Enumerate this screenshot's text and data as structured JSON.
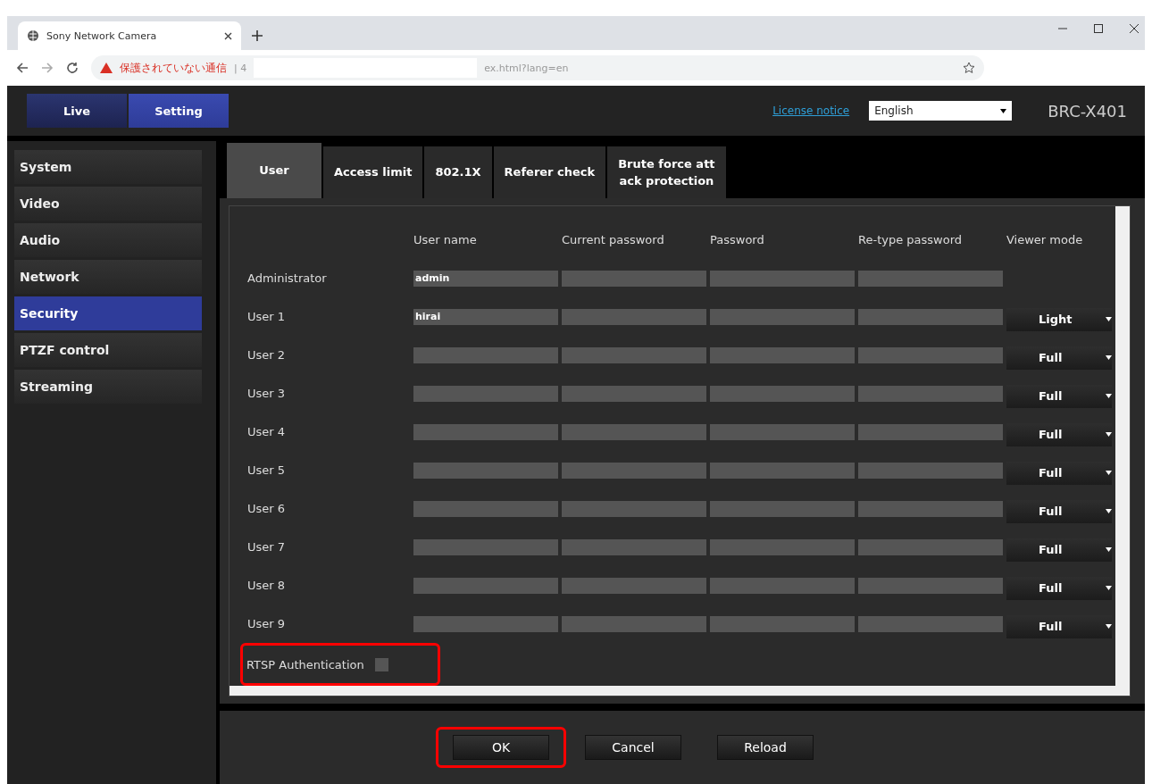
{
  "browser": {
    "tab_title": "Sony Network Camera",
    "security_label": "保護されていない通信",
    "url_prefix": "| 4",
    "url": "ex.html?lang=en"
  },
  "header": {
    "modes": [
      {
        "label": "Live",
        "selected": false
      },
      {
        "label": "Setting",
        "selected": true
      }
    ],
    "license_link": "License notice",
    "language": "English",
    "model": "BRC-X401"
  },
  "sidebar": {
    "items": [
      {
        "label": "System",
        "selected": false
      },
      {
        "label": "Video",
        "selected": false
      },
      {
        "label": "Audio",
        "selected": false
      },
      {
        "label": "Network",
        "selected": false
      },
      {
        "label": "Security",
        "selected": true
      },
      {
        "label": "PTZF control",
        "selected": false
      },
      {
        "label": "Streaming",
        "selected": false
      }
    ]
  },
  "tabs": [
    {
      "label": "User",
      "selected": true
    },
    {
      "label": "Access limit",
      "selected": false
    },
    {
      "label": "802.1X",
      "selected": false
    },
    {
      "label": "Referer check",
      "selected": false
    },
    {
      "label": "Brute force att\nack protection",
      "selected": false
    }
  ],
  "table": {
    "columns": [
      "User name",
      "Current password",
      "Password",
      "Re-type password",
      "Viewer mode"
    ],
    "rows": [
      {
        "label": "Administrator",
        "user_name": "admin"
      },
      {
        "label": "User 1",
        "user_name": "hirai",
        "viewer_mode": "Light"
      },
      {
        "label": "User 2",
        "viewer_mode": "Full"
      },
      {
        "label": "User 3",
        "viewer_mode": "Full"
      },
      {
        "label": "User 4",
        "viewer_mode": "Full"
      },
      {
        "label": "User 5",
        "viewer_mode": "Full"
      },
      {
        "label": "User 6",
        "viewer_mode": "Full"
      },
      {
        "label": "User 7",
        "viewer_mode": "Full"
      },
      {
        "label": "User 8",
        "viewer_mode": "Full"
      },
      {
        "label": "User 9",
        "viewer_mode": "Full"
      }
    ]
  },
  "rtsp": {
    "label": "RTSP Authentication",
    "checked": false,
    "highlighted": true
  },
  "buttons": [
    {
      "label": "OK",
      "highlighted": true
    },
    {
      "label": "Cancel",
      "highlighted": false
    },
    {
      "label": "Reload",
      "highlighted": false
    }
  ]
}
